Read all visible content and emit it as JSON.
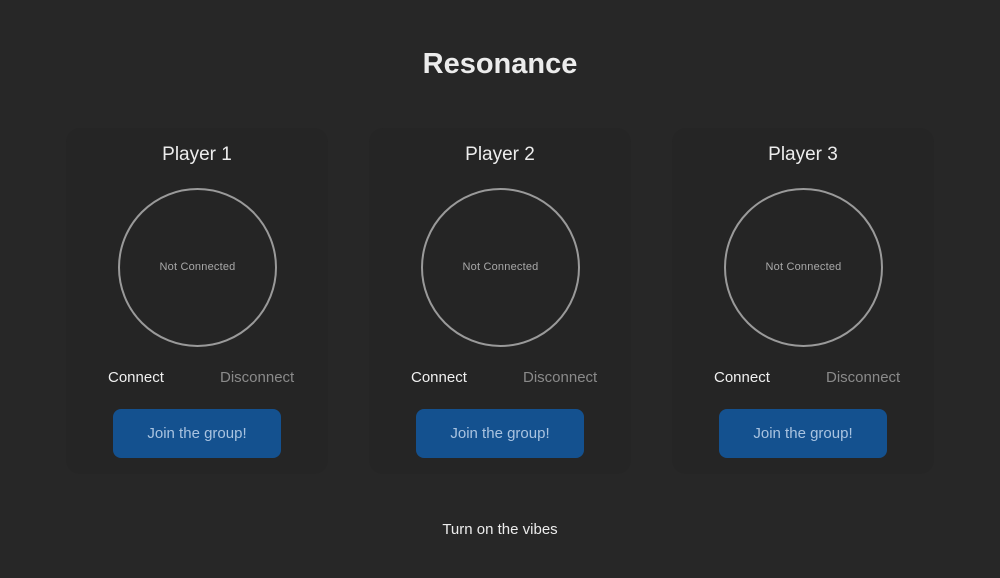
{
  "app": {
    "title": "Resonance"
  },
  "players": [
    {
      "name": "Player 1",
      "status": "Not Connected",
      "connect_label": "Connect",
      "disconnect_label": "Disconnect",
      "join_label": "Join the group!"
    },
    {
      "name": "Player 2",
      "status": "Not Connected",
      "connect_label": "Connect",
      "disconnect_label": "Disconnect",
      "join_label": "Join the group!"
    },
    {
      "name": "Player 3",
      "status": "Not Connected",
      "connect_label": "Connect",
      "disconnect_label": "Disconnect",
      "join_label": "Join the group!"
    }
  ],
  "footer": {
    "label": "Turn on the vibes"
  },
  "colors": {
    "background": "#272727",
    "card": "#252525",
    "join_button": "#14518f",
    "circle_border": "#9a9a9a"
  }
}
